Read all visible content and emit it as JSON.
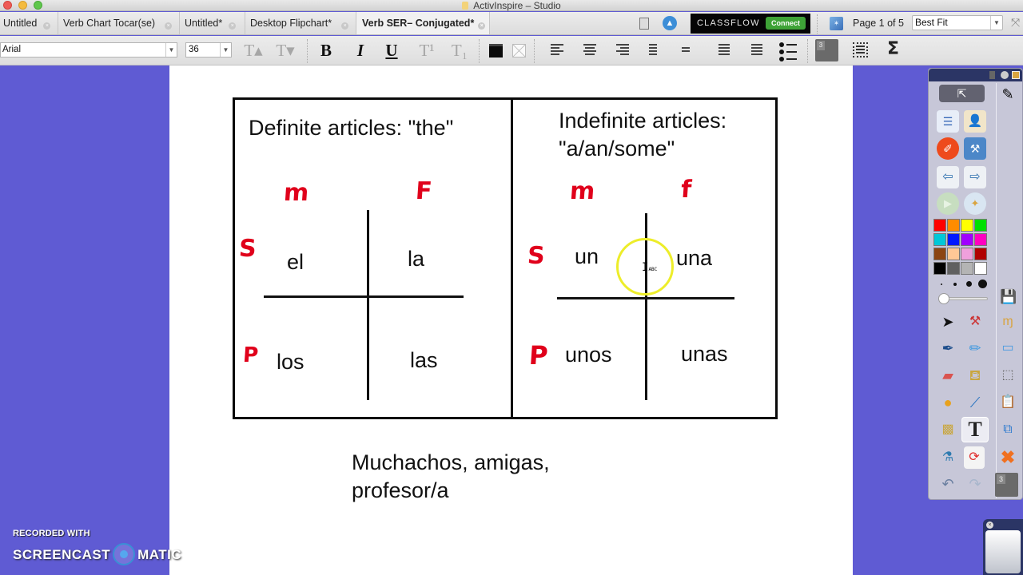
{
  "window": {
    "title": "ActivInspire – Studio"
  },
  "tabs": [
    {
      "label": "Untitled",
      "active": false
    },
    {
      "label": "Verb Chart Tocar(se)",
      "active": false
    },
    {
      "label": "Untitled*",
      "active": false
    },
    {
      "label": "Desktop Flipchart*",
      "active": false
    },
    {
      "label": "Verb SER– Conjugated*",
      "active": true
    }
  ],
  "topbar": {
    "classflow_label": "CLASSFLOW",
    "connect_label": "Connect",
    "page_indicator": "Page 1 of 5",
    "zoom_value": "Best Fit"
  },
  "format_toolbar": {
    "font_family_value": "Arial",
    "font_size_value": "36",
    "increase_size_glyph": "T▴",
    "decrease_size_glyph": "T▾",
    "bold_glyph": "B",
    "italic_glyph": "I",
    "underline_glyph": "U",
    "superscript_glyph": "T¹",
    "subscript_glyph": "T₁",
    "dock_number": "3",
    "sigma_glyph": "Σ"
  },
  "flipchart": {
    "definite": {
      "title": "Definite articles: \"the\"",
      "col_labels": [
        "m",
        "F"
      ],
      "row_labels": [
        "S",
        "P"
      ],
      "cells": {
        "singular_masculine": "el",
        "singular_feminine": "la",
        "plural_masculine": "los",
        "plural_feminine": "las"
      }
    },
    "indefinite": {
      "title": "Indefinite articles:\n\"a/an/some\"",
      "col_labels": [
        "m",
        "f"
      ],
      "row_labels": [
        "S",
        "P"
      ],
      "cells": {
        "singular_masculine": "un",
        "singular_feminine": "una",
        "plural_masculine": "unos",
        "plural_feminine": "unas"
      }
    },
    "note_line1": "Muchachos, amigas,",
    "note_line2": "profesor/a",
    "cursor_hint": "ABC"
  },
  "palette": {
    "colors": [
      "#ff0000",
      "#ff8c00",
      "#ffff00",
      "#00e000",
      "#00c8d8",
      "#0018ff",
      "#a000ff",
      "#ff00c0",
      "#8b4513",
      "#ffc896",
      "#f0a0dc",
      "#b00000",
      "#000000",
      "#606060",
      "#b4b4b4",
      "#ffffff"
    ],
    "pen_width_fraction": 0.05
  },
  "toolbox": {
    "dock_number": "3"
  },
  "watermark": {
    "line1": "RECORDED WITH",
    "brand_left": "SCREENCAST",
    "brand_right": "MATIC"
  },
  "colors": {
    "desktop_bg": "#5f5bd3",
    "annotation_red": "#e0001b",
    "classflow_green": "#3ea337",
    "spotlight_yellow": "#eded2a"
  }
}
